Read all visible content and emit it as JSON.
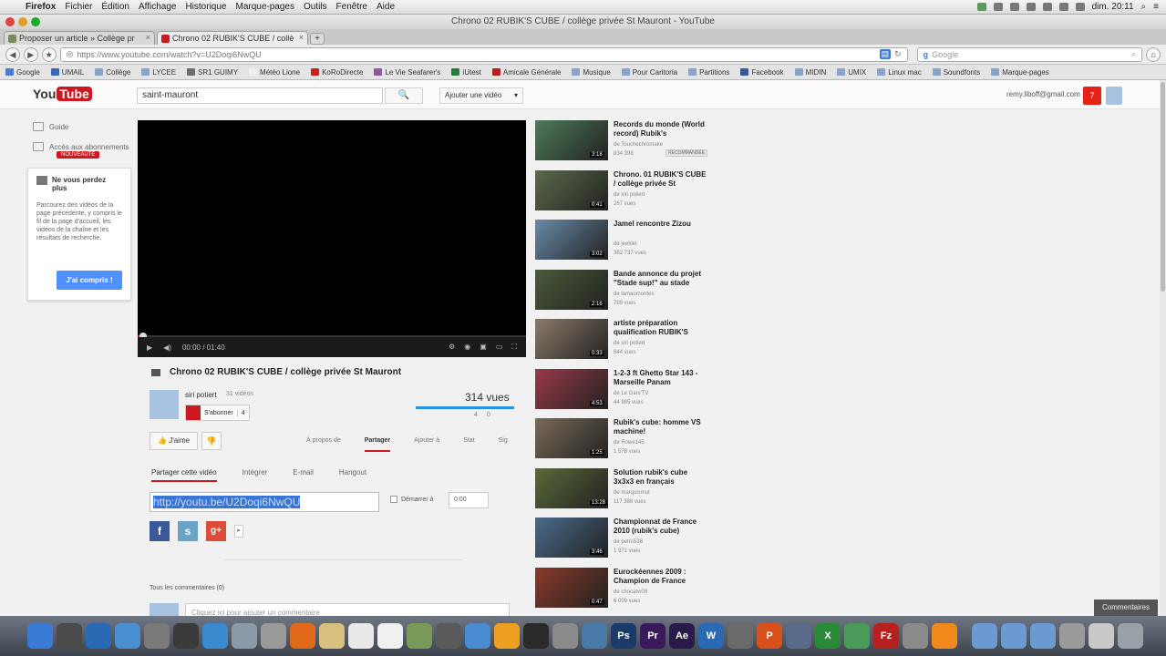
{
  "menubar": {
    "items": [
      "Firefox",
      "Fichier",
      "Édition",
      "Affichage",
      "Historique",
      "Marque-pages",
      "Outils",
      "Fenêtre",
      "Aide"
    ],
    "clock": "dim. 20:11"
  },
  "window": {
    "title": "Chrono 02 RUBIK'S CUBE / collège privée St Mauront - YouTube"
  },
  "tabs": [
    {
      "label": "Proposer un article » Collège pr",
      "active": false,
      "favicon_color": "#7a8c5a"
    },
    {
      "label": "Chrono 02 RUBIK'S CUBE / collè",
      "active": true,
      "favicon_color": "#cc181e"
    }
  ],
  "nav": {
    "back": "◀",
    "forward": "▶",
    "url": "https://www.youtube.com/watch?v=U2Doqi6NwQU",
    "search_placeholder": "Google"
  },
  "bookmarks": [
    {
      "label": "Google",
      "color": "#4a7bd0"
    },
    {
      "label": "UMAIL",
      "color": "#3d68b5"
    },
    {
      "label": "Collège",
      "color": "#8aa3c8"
    },
    {
      "label": "LYCEE",
      "color": "#8aa3c8"
    },
    {
      "label": "SR1 GUIMY",
      "color": "#6c6c6c"
    },
    {
      "label": "Météo Lione",
      "color": "#f0f0f0"
    },
    {
      "label": "KoRoDirecte",
      "color": "#cc2020"
    },
    {
      "label": "Le Vie Seafarer's",
      "color": "#8a5a9a"
    },
    {
      "label": "iUtest",
      "color": "#2a7a3a"
    },
    {
      "label": "Amicale Générale",
      "color": "#b81e1e"
    },
    {
      "label": "Musique",
      "color": "#8aa3c8"
    },
    {
      "label": "Pour Caritoria",
      "color": "#8aa3c8"
    },
    {
      "label": "Partitions",
      "color": "#8aa3c8"
    },
    {
      "label": "Facebook",
      "color": "#3b5998"
    },
    {
      "label": "MIDIN",
      "color": "#8aa3c8"
    },
    {
      "label": "UMIX",
      "color": "#8aa3c8"
    },
    {
      "label": "Linux mac",
      "color": "#8aa3c8"
    },
    {
      "label": "Soundfonts",
      "color": "#8aa3c8"
    },
    {
      "label": "Marque-pages",
      "color": "#8aa3c8"
    }
  ],
  "yt": {
    "logo_you": "You",
    "logo_tube": "Tube",
    "search_value": "saint-mauront",
    "search_icon": "🔍",
    "upload_label": "Ajouter une vidéo",
    "upload_arrow": "▾",
    "user_email": "remy.liboff@gmail.com",
    "notif_count": "7"
  },
  "guide": {
    "item1": "Guide",
    "item2": "Accès aux abonnements",
    "badge": "NOUVEAUTÉ",
    "tip_title": "Ne vous perdez plus",
    "tip_body": "Parcourez des vidéos de la page précédente, y compris le fil de la page d'accueil, les vidéos de la chaîne et les résultats de recherche.",
    "tip_button": "J'ai compris !"
  },
  "player": {
    "play": "▶",
    "volume": "◀)",
    "time": "00:00 / 01:40",
    "progress": 0.0
  },
  "video": {
    "title": "Chrono 02 RUBIK'S CUBE / collège privée St Mauront",
    "channel": "siri potiert",
    "channel_videos": "31 vidéos",
    "subscribe": "S'abonner",
    "sub_count": "4",
    "views": "314 vues",
    "likes": "4",
    "dislikes": "0",
    "like_label": "J'aime",
    "dislike_label": "👎",
    "action_tabs": [
      "À propos de",
      "Partager",
      "Ajouter à",
      "Stat",
      "Sig"
    ],
    "active_action_tab": "Partager",
    "share_tabs": [
      "Partager cette vidéo",
      "Intégrer",
      "E-mail",
      "Hangout"
    ],
    "active_share_tab": "Partager cette vidéo",
    "share_url": "http://youtu.be/U2Doqi6NwQU",
    "start_at_label": "Démarrer à",
    "start_time": "0:00",
    "social": [
      {
        "name": "facebook",
        "glyph": "f",
        "color": "#3b5998"
      },
      {
        "name": "skyrock",
        "glyph": "s",
        "color": "#6aa2c8"
      },
      {
        "name": "google-plus",
        "glyph": "g+",
        "color": "#dd4b39"
      }
    ],
    "comments_label": "Tous les commentaires (0)",
    "comment_placeholder": "Cliquez ici pour ajouter un commentaire"
  },
  "recommendations": [
    {
      "title": "Records du monde (World record) Rubik's",
      "channel": "de Touchechromake",
      "views": "834 398",
      "duration": "3:18",
      "badge": "RECOMMANDÉE",
      "thumb_color": "#4d7a5a"
    },
    {
      "title": "Chrono. 01 RUBIK'S CUBE / collège privée St",
      "channel": "de siri potiert",
      "views": "267 vues",
      "duration": "0:41",
      "badge": "",
      "thumb_color": "#5a6a4a"
    },
    {
      "title": "Jamel rencontre Zizou",
      "channel": "de jeeklet",
      "views": "382 737 vues",
      "duration": "3:02",
      "badge": "",
      "thumb_color": "#6a8aa8"
    },
    {
      "title": "Bande annonce du projet \"Stade sup!\" au stade",
      "channel": "de lamaomontes",
      "views": "789 vues",
      "duration": "2:16",
      "badge": "",
      "thumb_color": "#4a5a3a"
    },
    {
      "title": "artiste préparation qualification RUBIK'S",
      "channel": "de siri potiert",
      "views": "844 vues",
      "duration": "0:33",
      "badge": "",
      "thumb_color": "#8a7a6a"
    },
    {
      "title": "1-2-3 ft Ghetto Star 143 - Marseille Panam",
      "channel": "de Le Gars'TV",
      "views": "44 985 vues",
      "duration": "4:53",
      "badge": "",
      "thumb_color": "#9a3a4a"
    },
    {
      "title": "Rubik's cube: homme VS machine!",
      "channel": "de Rowe145",
      "views": "1 578 vues",
      "duration": "1:25",
      "badge": "",
      "thumb_color": "#7a6a5a"
    },
    {
      "title": "Solution rubik's cube 3x3x3 en français",
      "channel": "de marquismut",
      "views": "117 388 vues",
      "duration": "13:28",
      "badge": "",
      "thumb_color": "#5a6a3a"
    },
    {
      "title": "Championnat de France 2010 (rubik's cube)",
      "channel": "de petro538",
      "views": "1 971 vues",
      "duration": "3:46",
      "badge": "",
      "thumb_color": "#4a6a8a"
    },
    {
      "title": "Eurockéennes 2009 : Champion de France",
      "channel": "de chocatw08",
      "views": "6 009 vues",
      "duration": "0:47",
      "badge": "",
      "thumb_color": "#8a3a2a"
    }
  ],
  "comment_tab": "Commentaires",
  "dock": [
    {
      "name": "finder",
      "color": "#3a7bd5",
      "glyph": ""
    },
    {
      "name": "dashboard",
      "color": "#4a4a4a",
      "glyph": ""
    },
    {
      "name": "spotlight",
      "color": "#2a6ab5",
      "glyph": ""
    },
    {
      "name": "safari",
      "color": "#4a90d0",
      "glyph": ""
    },
    {
      "name": "launchpad",
      "color": "#7a7a7a",
      "glyph": ""
    },
    {
      "name": "mission-control",
      "color": "#3a3a3a",
      "glyph": ""
    },
    {
      "name": "appstore",
      "color": "#3a8ad0",
      "glyph": ""
    },
    {
      "name": "preview",
      "color": "#8a9aa8",
      "glyph": ""
    },
    {
      "name": "system-prefs",
      "color": "#9a9a9a",
      "glyph": ""
    },
    {
      "name": "firefox",
      "color": "#e06a1a",
      "glyph": ""
    },
    {
      "name": "notes",
      "color": "#d8c080",
      "glyph": ""
    },
    {
      "name": "calendar",
      "color": "#e8e8e8",
      "glyph": ""
    },
    {
      "name": "textedit",
      "color": "#f0f0f0",
      "glyph": ""
    },
    {
      "name": "photos",
      "color": "#7a9a5a",
      "glyph": ""
    },
    {
      "name": "games",
      "color": "#5a5a5a",
      "glyph": ""
    },
    {
      "name": "itunes",
      "color": "#4a8ad0",
      "glyph": ""
    },
    {
      "name": "vlc",
      "color": "#f0a020",
      "glyph": ""
    },
    {
      "name": "terminal",
      "color": "#2a2a2a",
      "glyph": ""
    },
    {
      "name": "xcode",
      "color": "#8a8a8a",
      "glyph": ""
    },
    {
      "name": "iphoto",
      "color": "#4a7aa8",
      "glyph": ""
    },
    {
      "name": "photoshop",
      "color": "#1a3a6a",
      "glyph": "Ps"
    },
    {
      "name": "premiere",
      "color": "#3a1a5a",
      "glyph": "Pr"
    },
    {
      "name": "after-effects",
      "color": "#2a1a4a",
      "glyph": "Ae"
    },
    {
      "name": "word",
      "color": "#2a6ab5",
      "glyph": "W"
    },
    {
      "name": "tools",
      "color": "#6a6a6a",
      "glyph": ""
    },
    {
      "name": "powerpoint",
      "color": "#d8501a",
      "glyph": "P"
    },
    {
      "name": "keynote",
      "color": "#5a6a8a",
      "glyph": ""
    },
    {
      "name": "excel",
      "color": "#2a8a3a",
      "glyph": "X"
    },
    {
      "name": "numbers",
      "color": "#4a9a5a",
      "glyph": ""
    },
    {
      "name": "filezilla",
      "color": "#b82020",
      "glyph": "Fz"
    },
    {
      "name": "archive",
      "color": "#8a8a8a",
      "glyph": ""
    },
    {
      "name": "vlc-cone",
      "color": "#f08a1a",
      "glyph": ""
    },
    {
      "name": "apps-folder",
      "color": "#6a9ad0",
      "glyph": ""
    },
    {
      "name": "documents-folder",
      "color": "#6a9ad0",
      "glyph": ""
    },
    {
      "name": "downloads-folder",
      "color": "#6a9ad0",
      "glyph": ""
    },
    {
      "name": "drive",
      "color": "#9a9a9a",
      "glyph": ""
    },
    {
      "name": "screen",
      "color": "#c8c8c8",
      "glyph": ""
    },
    {
      "name": "trash",
      "color": "#9aa0a8",
      "glyph": ""
    }
  ]
}
